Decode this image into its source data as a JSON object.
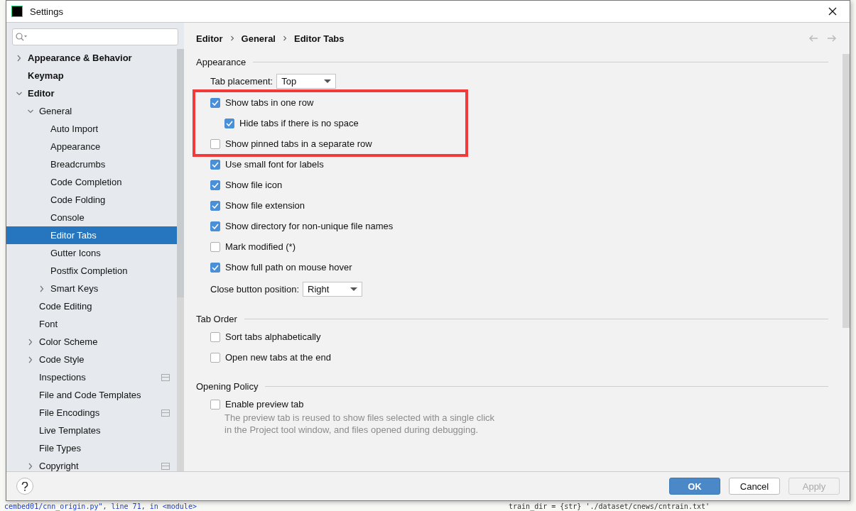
{
  "window": {
    "title": "Settings"
  },
  "sidebar": {
    "tree": [
      {
        "label": "Appearance & Behavior",
        "expanded": false,
        "scope_icon": false
      },
      {
        "label": "Keymap",
        "scope_icon": false
      },
      {
        "label": "Editor",
        "expanded": true,
        "scope_icon": false,
        "children": [
          {
            "label": "General",
            "expanded": true,
            "scope_icon": false,
            "children": [
              {
                "label": "Auto Import",
                "selected": false,
                "scope_icon": false
              },
              {
                "label": "Appearance",
                "selected": false,
                "scope_icon": false
              },
              {
                "label": "Breadcrumbs",
                "selected": false,
                "scope_icon": false
              },
              {
                "label": "Code Completion",
                "selected": false,
                "scope_icon": false
              },
              {
                "label": "Code Folding",
                "selected": false,
                "scope_icon": false
              },
              {
                "label": "Console",
                "selected": false,
                "scope_icon": false
              },
              {
                "label": "Editor Tabs",
                "selected": true,
                "scope_icon": false
              },
              {
                "label": "Gutter Icons",
                "selected": false,
                "scope_icon": false
              },
              {
                "label": "Postfix Completion",
                "selected": false,
                "scope_icon": false
              },
              {
                "label": "Smart Keys",
                "expanded": false,
                "selected": false,
                "scope_icon": false
              }
            ]
          },
          {
            "label": "Code Editing",
            "selected": false,
            "scope_icon": false
          },
          {
            "label": "Font",
            "selected": false,
            "scope_icon": false
          },
          {
            "label": "Color Scheme",
            "expanded": false,
            "selected": false,
            "scope_icon": false
          },
          {
            "label": "Code Style",
            "expanded": false,
            "selected": false,
            "scope_icon": false
          },
          {
            "label": "Inspections",
            "selected": false,
            "scope_icon": true
          },
          {
            "label": "File and Code Templates",
            "selected": false,
            "scope_icon": false
          },
          {
            "label": "File Encodings",
            "selected": false,
            "scope_icon": true
          },
          {
            "label": "Live Templates",
            "selected": false,
            "scope_icon": false
          },
          {
            "label": "File Types",
            "selected": false,
            "scope_icon": false
          },
          {
            "label": "Copyright",
            "expanded": false,
            "selected": false,
            "scope_icon": true
          }
        ]
      }
    ]
  },
  "breadcrumbs": [
    "Editor",
    "General",
    "Editor Tabs"
  ],
  "sections": [
    {
      "title": "Appearance",
      "items": [
        {
          "kind": "dropdown",
          "label": "Tab placement:",
          "value": "Top"
        },
        {
          "kind": "checkbox",
          "label": "Show tabs in one row",
          "checked": true,
          "highlighted": true,
          "children": [
            {
              "kind": "checkbox",
              "label": "Hide tabs if there is no space",
              "checked": true
            }
          ]
        },
        {
          "kind": "checkbox",
          "label": "Show pinned tabs in a separate row",
          "checked": false,
          "highlighted": true
        },
        {
          "kind": "checkbox",
          "label": "Use small font for labels",
          "checked": true,
          "highlighted": false
        },
        {
          "kind": "checkbox",
          "label": "Show file icon",
          "checked": true,
          "highlighted": false
        },
        {
          "kind": "checkbox",
          "label": "Show file extension",
          "checked": true,
          "highlighted": false
        },
        {
          "kind": "checkbox",
          "label": "Show directory for non-unique file names",
          "checked": true,
          "highlighted": false
        },
        {
          "kind": "checkbox",
          "label": "Mark modified (*)",
          "checked": false,
          "highlighted": false
        },
        {
          "kind": "checkbox",
          "label": "Show full path on mouse hover",
          "checked": true,
          "highlighted": false
        },
        {
          "kind": "dropdown",
          "label": "Close button position:",
          "value": "Right"
        }
      ]
    },
    {
      "title": "Tab Order",
      "items": [
        {
          "kind": "checkbox",
          "label": "Sort tabs alphabetically",
          "checked": false,
          "highlighted": false
        },
        {
          "kind": "checkbox",
          "label": "Open new tabs at the end",
          "checked": false,
          "highlighted": false
        }
      ]
    },
    {
      "title": "Opening Policy",
      "items": [
        {
          "kind": "checkbox",
          "label": "Enable preview tab",
          "checked": false,
          "highlighted": false,
          "description": "The preview tab is reused to show files selected with a single click\nin the Project tool window, and files opened during debugging."
        }
      ]
    }
  ],
  "buttons": [
    {
      "label": "OK",
      "kind": "primary",
      "disabled": false
    },
    {
      "label": "Cancel",
      "kind": "normal",
      "disabled": false
    },
    {
      "label": "Apply",
      "kind": "normal",
      "disabled": true
    }
  ],
  "background_editor": {
    "lines": [
      {
        "text": "cembed01/cnn_origin.py\", line 71, in <module>"
      },
      {
        "text": "train_dir = {str} './dataset/cnews/cntrain.txt'"
      }
    ]
  }
}
